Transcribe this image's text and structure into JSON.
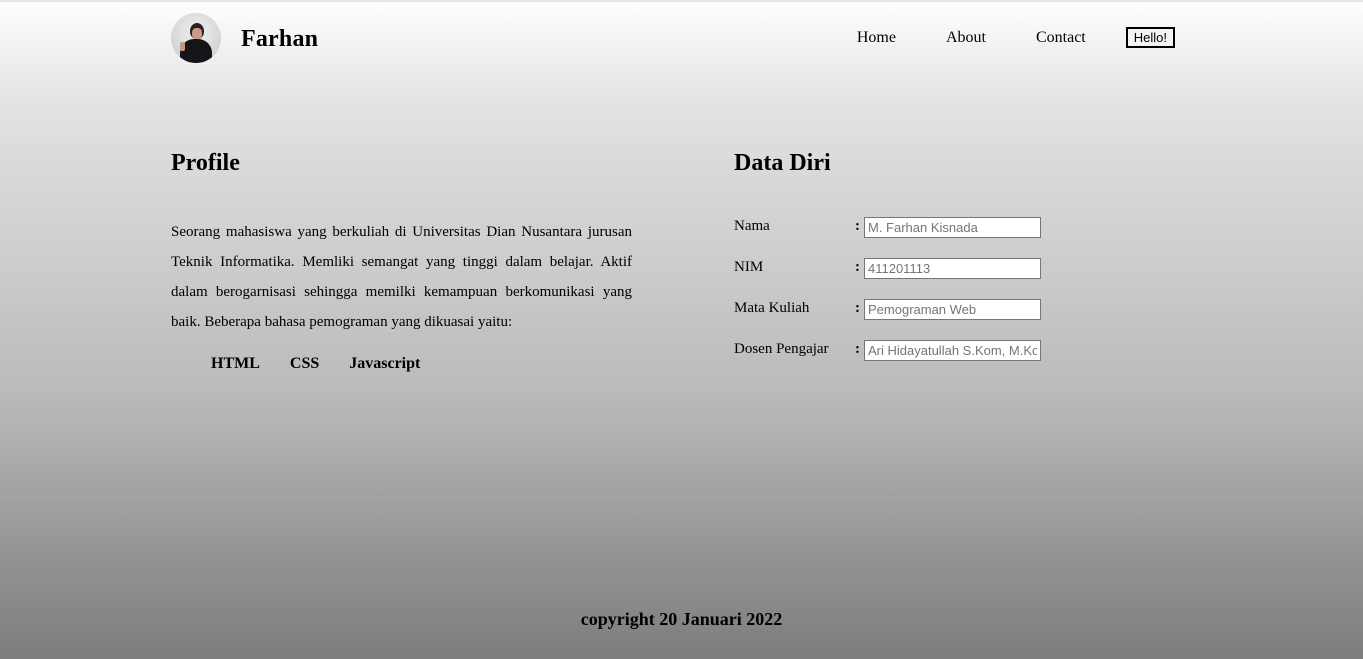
{
  "header": {
    "brand": "Farhan",
    "nav": [
      "Home",
      "About",
      "Contact"
    ],
    "hello_button": "Hello!"
  },
  "profile": {
    "title": "Profile",
    "text": "Seorang mahasiswa yang berkuliah di Universitas Dian Nusantara jurusan Teknik Informatika. Memliki semangat yang tinggi dalam belajar. Aktif dalam berogarnisasi sehingga memilki kemampuan berkomunikasi yang baik. Beberapa bahasa pemograman yang dikuasai yaitu:",
    "skills": [
      "HTML",
      "CSS",
      "Javascript"
    ]
  },
  "data_diri": {
    "title": "Data Diri",
    "colon": ":",
    "fields": [
      {
        "label": "Nama",
        "placeholder": "M. Farhan Kisnada"
      },
      {
        "label": "NIM",
        "placeholder": "411201113"
      },
      {
        "label": "Mata Kuliah",
        "placeholder": "Pemograman Web"
      },
      {
        "label": "Dosen Pengajar",
        "placeholder": "Ari Hidayatullah S.Kom, M.Kom"
      }
    ]
  },
  "footer": {
    "text": "copyright 20 Januari 2022"
  }
}
